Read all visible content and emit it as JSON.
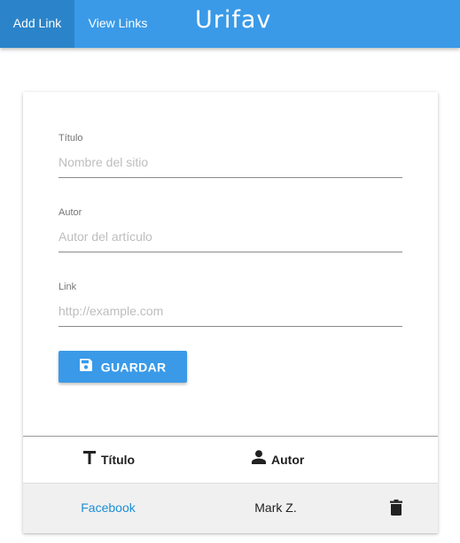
{
  "nav": {
    "tabs": [
      {
        "label": "Add Link",
        "active": true
      },
      {
        "label": "View Links",
        "active": false
      }
    ],
    "brand": "Urifav",
    "colors": {
      "bar": "#3a9ae8",
      "active_tab": "#2b84c9"
    }
  },
  "form": {
    "fields": [
      {
        "label": "Título",
        "placeholder": "Nombre del sitio",
        "value": ""
      },
      {
        "label": "Autor",
        "placeholder": "Autor del artículo",
        "value": ""
      },
      {
        "label": "Link",
        "placeholder": "http://example.com",
        "value": ""
      }
    ],
    "save_button": {
      "label": "GUARDAR",
      "icon": "floppy-disk-icon"
    }
  },
  "table": {
    "columns": [
      {
        "label": "Título",
        "icon": "text-format-icon"
      },
      {
        "label": "Autor",
        "icon": "person-icon"
      }
    ],
    "rows": [
      {
        "title": "Facebook",
        "author": "Mark Z.",
        "action_icon": "trash-icon"
      }
    ]
  }
}
